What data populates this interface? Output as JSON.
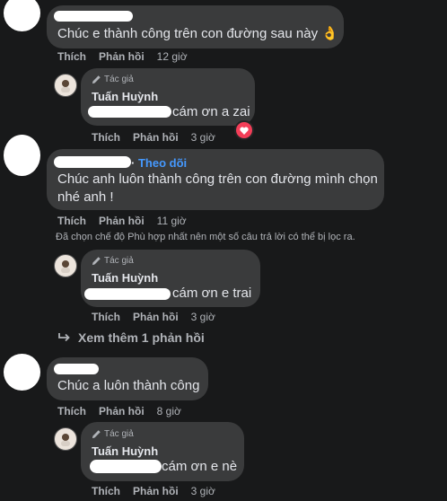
{
  "comments": [
    {
      "text": "Chúc e thành công trên con đường sau này 👌",
      "actions": {
        "like": "Thích",
        "reply": "Phản hồi",
        "time": "12 giờ"
      },
      "reply": {
        "author_badge": "Tác giả",
        "author": "Tuấn Huỳnh",
        "text": "cám ơn a zai",
        "actions": {
          "like": "Thích",
          "reply": "Phản hồi",
          "time": "3 giờ"
        }
      }
    },
    {
      "follow_label": "Theo dõi",
      "text": "Chúc anh luôn thành công trên con đường mình chọn nhé anh !",
      "actions": {
        "like": "Thích",
        "reply": "Phản hồi",
        "time": "11 giờ"
      },
      "notice": "Đã chọn chế độ Phù hợp nhất nên một số câu trả lời có thể bị lọc ra.",
      "reply": {
        "author_badge": "Tác giả",
        "author": "Tuấn Huỳnh",
        "text": "cám ơn e trai",
        "actions": {
          "like": "Thích",
          "reply": "Phản hồi",
          "time": "3 giờ"
        }
      },
      "more_replies": "Xem thêm 1 phản hồi"
    },
    {
      "text": "Chúc a luôn thành công",
      "actions": {
        "like": "Thích",
        "reply": "Phản hồi",
        "time": "8 giờ"
      },
      "reply": {
        "author_badge": "Tác giả",
        "author": "Tuấn Huỳnh",
        "text": "cám ơn e nè",
        "actions": {
          "like": "Thích",
          "reply": "Phản hồi",
          "time": "3 giờ"
        }
      }
    }
  ],
  "colors": {
    "background": "#18191a",
    "bubble": "#3a3b3c",
    "link": "#4599ff",
    "reaction": "#f33e58"
  }
}
